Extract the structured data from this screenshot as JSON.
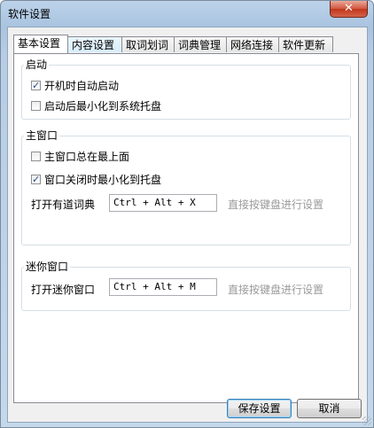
{
  "window": {
    "title": "软件设置",
    "close_glyph": "✕"
  },
  "tabs": [
    {
      "label": "基本设置",
      "active": true
    },
    {
      "label": "内容设置",
      "active": false
    },
    {
      "label": "取词划词",
      "active": false
    },
    {
      "label": "词典管理",
      "active": false
    },
    {
      "label": "网络连接",
      "active": false
    },
    {
      "label": "软件更新",
      "active": false
    }
  ],
  "startup": {
    "title": "启动",
    "auto_start": {
      "label": "开机时自动启动",
      "checked": true
    },
    "minimize_to_tray": {
      "label": "启动后最小化到系统托盘",
      "checked": false
    }
  },
  "main_window": {
    "title": "主窗口",
    "always_on_top": {
      "label": "主窗口总在最上面",
      "checked": false
    },
    "close_to_tray": {
      "label": "窗口关闭时最小化到托盘",
      "checked": true
    },
    "open_label": "打开有道词典",
    "open_hotkey": "Ctrl + Alt + X",
    "hint": "直接按键盘进行设置"
  },
  "mini_window": {
    "title": "迷你窗口",
    "open_label": "打开迷你窗口",
    "open_hotkey": "Ctrl + Alt + M",
    "hint": "直接按键盘进行设置"
  },
  "buttons": {
    "save": "保存设置",
    "cancel": "取消"
  },
  "icons": {
    "check": "✓"
  }
}
